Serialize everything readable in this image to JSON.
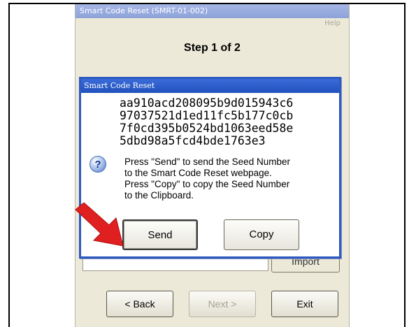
{
  "window": {
    "title": "Smart Code Reset (SMRT-01-002)",
    "help_label": "Help",
    "step_text": "Step 1 of 2",
    "background_button_label": "Import"
  },
  "dialog": {
    "title": "Smart Code Reset",
    "seed_lines": [
      "aa910acd208095b9d015943c6",
      "97037521d1ed11fc5b177c0cb",
      "7f0cd395b0524bd1063eed58e",
      "5dbd98a5fcd4bde1763e3"
    ],
    "icon": "question-icon",
    "message_lines": [
      "Press \"Send\" to send the Seed Number",
      "to the Smart Code Reset webpage.",
      "Press \"Copy\" to copy the Seed Number",
      "to the Clipboard."
    ],
    "send_label": "Send",
    "copy_label": "Copy"
  },
  "nav": {
    "back_label": "< Back",
    "next_label": "Next >",
    "exit_label": "Exit"
  },
  "colors": {
    "dialog_border": "#2e59c0",
    "window_bg": "#ece9d8",
    "arrow": "#e02020"
  }
}
